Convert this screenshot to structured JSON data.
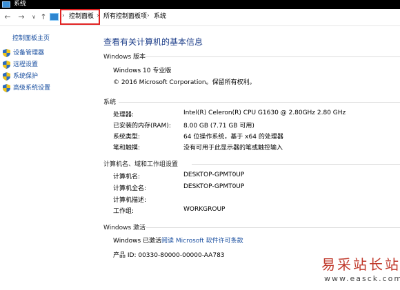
{
  "window": {
    "title": "系统"
  },
  "breadcrumb": {
    "items": [
      "控制面板",
      "所有控制面板项",
      "系统"
    ]
  },
  "sidebar": {
    "home_label": "控制面板主页",
    "items": [
      {
        "label": "设备管理器",
        "icon": "shield-icon"
      },
      {
        "label": "远程设置",
        "icon": "shield-icon"
      },
      {
        "label": "系统保护",
        "icon": "shield-icon"
      },
      {
        "label": "高级系统设置",
        "icon": "shield-icon"
      }
    ]
  },
  "main": {
    "title": "查看有关计算机的基本信息",
    "edition": {
      "header": "Windows 版本",
      "name": "Windows 10 专业版",
      "copyright": "© 2016 Microsoft Corporation。保留所有权利。"
    },
    "system": {
      "header": "系统",
      "rows": [
        {
          "label": "处理器:",
          "value": "Intel(R) Celeron(R) CPU G1630 @ 2.80GHz   2.80 GHz"
        },
        {
          "label": "已安装的内存(RAM):",
          "value": "8.00 GB (7.71 GB 可用)"
        },
        {
          "label": "系统类型:",
          "value": "64 位操作系统，基于 x64 的处理器"
        },
        {
          "label": "笔和触摸:",
          "value": "没有可用于此显示器的笔或触控输入"
        }
      ]
    },
    "computer": {
      "header": "计算机名、域和工作组设置",
      "rows": [
        {
          "label": "计算机名:",
          "value": "DESKTOP-GPMT0UP"
        },
        {
          "label": "计算机全名:",
          "value": "DESKTOP-GPMT0UP"
        },
        {
          "label": "计算机描述:",
          "value": ""
        },
        {
          "label": "工作组:",
          "value": "WORKGROUP"
        }
      ]
    },
    "activation": {
      "header": "Windows 激活",
      "status": "Windows 已激活",
      "license_link": "阅读 Microsoft 软件许可条款",
      "product_id": "产品 ID: 00330-80000-00000-AA783"
    }
  },
  "watermark": {
    "text": "易采站长站",
    "url": "www.easck.com"
  },
  "colors": {
    "link": "#1a4fa0",
    "title": "#1e3f8a",
    "highlight": "#e02020",
    "watermark": "#c0392b"
  }
}
